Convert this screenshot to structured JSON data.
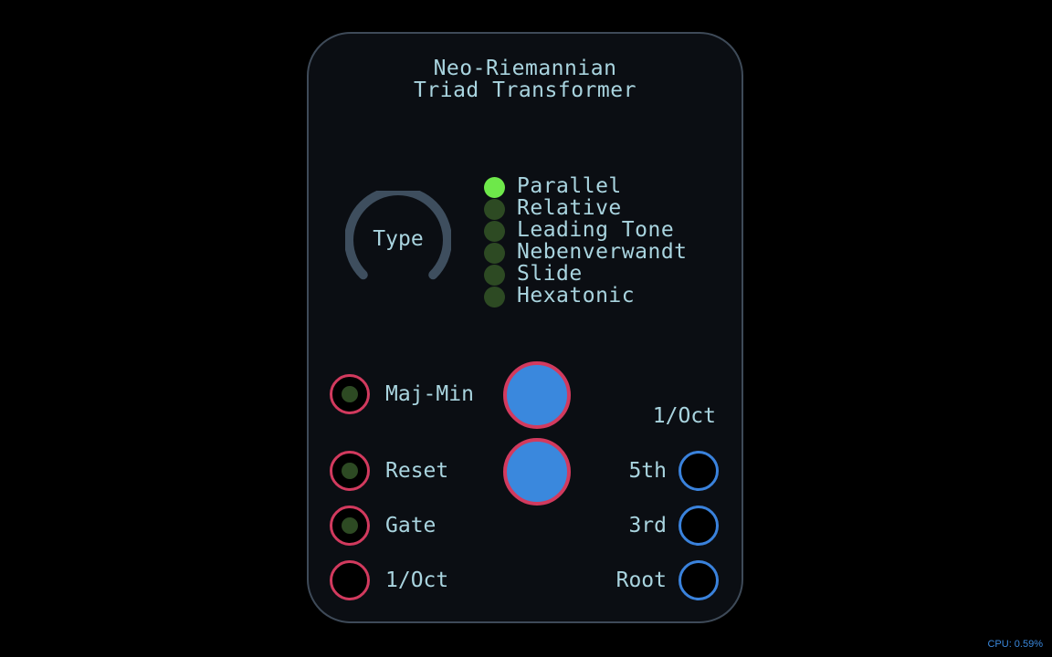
{
  "module": {
    "title_line1": "Neo-Riemannian",
    "title_line2": "Triad Transformer",
    "knob": {
      "label": "Type"
    },
    "modes": [
      {
        "label": "Parallel",
        "active": true
      },
      {
        "label": "Relative",
        "active": false
      },
      {
        "label": "Leading Tone",
        "active": false
      },
      {
        "label": "Nebenverwandt",
        "active": false
      },
      {
        "label": "Slide",
        "active": false
      },
      {
        "label": "Hexatonic",
        "active": false
      }
    ],
    "inputs": {
      "maj_min": "Maj-Min",
      "reset": "Reset",
      "gate": "Gate",
      "oct": "1/Oct"
    },
    "outputs": {
      "header": "1/Oct",
      "fifth": "5th",
      "third": "3rd",
      "root": "Root"
    }
  },
  "status": {
    "cpu": "CPU: 0.59%"
  },
  "colors": {
    "input_ring": "#d23a5e",
    "output_ring": "#3a82dc",
    "led_on": "#6ee84a",
    "led_off": "#2d4a23",
    "button_fill": "#3a88dd",
    "text": "#a9d4df"
  }
}
